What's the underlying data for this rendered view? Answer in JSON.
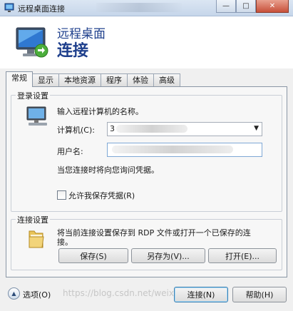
{
  "window": {
    "title": "远程桌面连接",
    "caption_buttons": {
      "minimize": "—",
      "maximize": "□",
      "close": "✕"
    }
  },
  "banner": {
    "line1": "远程桌面",
    "line2": "连接"
  },
  "tabs": [
    {
      "label": "常规",
      "active": true
    },
    {
      "label": "显示",
      "active": false
    },
    {
      "label": "本地资源",
      "active": false
    },
    {
      "label": "程序",
      "active": false
    },
    {
      "label": "体验",
      "active": false
    },
    {
      "label": "高级",
      "active": false
    }
  ],
  "logon": {
    "legend": "登录设置",
    "prompt": "输入远程计算机的名称。",
    "computer_label": "计算机(C):",
    "computer_value": "3",
    "username_label": "用户名:",
    "username_value": "",
    "note": "当您连接时将向您询问凭据。",
    "save_credentials_label": "允许我保存凭据(R)",
    "save_credentials_checked": false
  },
  "connection": {
    "legend": "连接设置",
    "description_line1": "将当前连接设置保存到 RDP 文件或打开一个已保存的连",
    "description_line2": "接。",
    "save_label": "保存(S)",
    "save_as_label": "另存为(V)...",
    "open_label": "打开(E)..."
  },
  "footer": {
    "options_label": "选项(O)",
    "connect_label": "连接(N)",
    "help_label": "帮助(H)",
    "watermark": "https://blog.csdn.net/weixin_4..."
  },
  "colors": {
    "accent": "#1e3f8c",
    "titlebar": "#c6d6ea",
    "close": "#c8503a"
  }
}
